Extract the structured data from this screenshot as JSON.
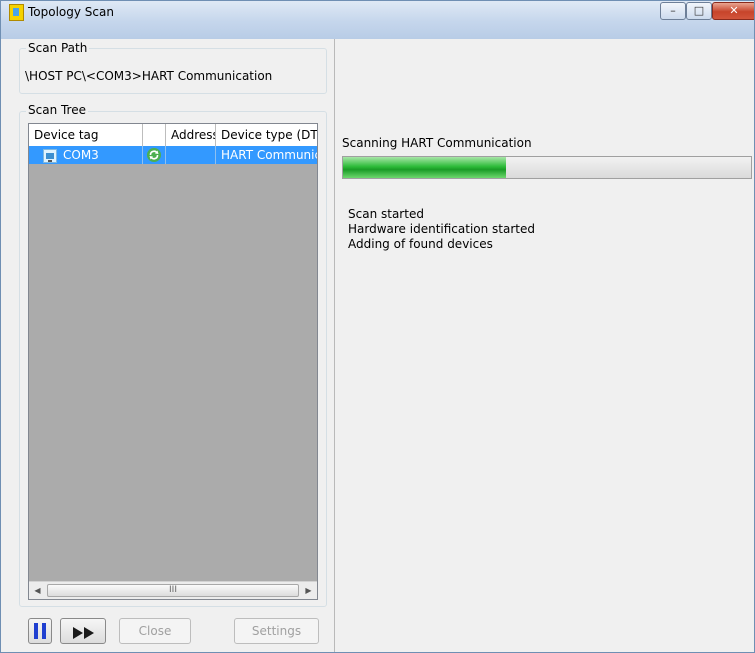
{
  "window": {
    "title": "Topology Scan"
  },
  "titlebar_buttons": {
    "minimize": "–",
    "maximize": "□",
    "close": "✕"
  },
  "scan_path": {
    "label": "Scan Path",
    "value": "\\HOST PC\\<COM3>HART Communication"
  },
  "scan_tree": {
    "label": "Scan Tree",
    "columns": [
      "Device tag",
      "",
      "Address",
      "Device type (DTM"
    ],
    "rows": [
      {
        "device_tag": "COM3",
        "icon": "scan-refresh-icon",
        "address": "",
        "device_type": "HART Communic"
      }
    ],
    "scroll_thumb_grip": "III"
  },
  "toolbar": {
    "pause_icon": "pause-icon",
    "resume_icon": "fast-forward-icon",
    "close_label": "Close",
    "settings_label": "Settings"
  },
  "status": {
    "label": "Scanning HART Communication",
    "progress": 0.4
  },
  "log": [
    "Scan started",
    "Hardware identification started",
    "Adding of found devices"
  ],
  "colors": {
    "selection": "#3399ff",
    "progress": "#2ebc3a",
    "pause": "#1f3fd0"
  }
}
